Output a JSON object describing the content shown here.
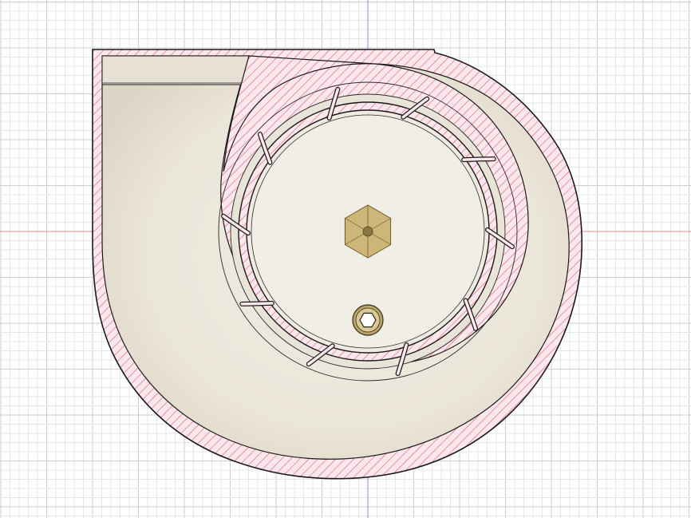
{
  "viewport": {
    "background": "#ffffff",
    "grid_major_color": "#c9ced3",
    "grid_minor_color": "#e4e7ea",
    "axis_x_color": "#e58c8c",
    "axis_y_color": "#8c8ce5",
    "axes_visible": true,
    "grid_visible": true
  },
  "model": {
    "name_hint": "centrifugal-blower-housing-section",
    "section_fill": "#fbe7ec",
    "section_hatch_color": "#e0506e",
    "outline_color": "#1a1a1a",
    "surface_color": "#ece8dd",
    "surface_shadow_color": "#d8d2c3",
    "impeller_vane_count": 10,
    "icons": [
      "hex-nut-icon",
      "hex-socket-bolt-icon"
    ],
    "hex_nut_color": "#cdb778",
    "hex_bolt_color": "#b9a56a"
  }
}
